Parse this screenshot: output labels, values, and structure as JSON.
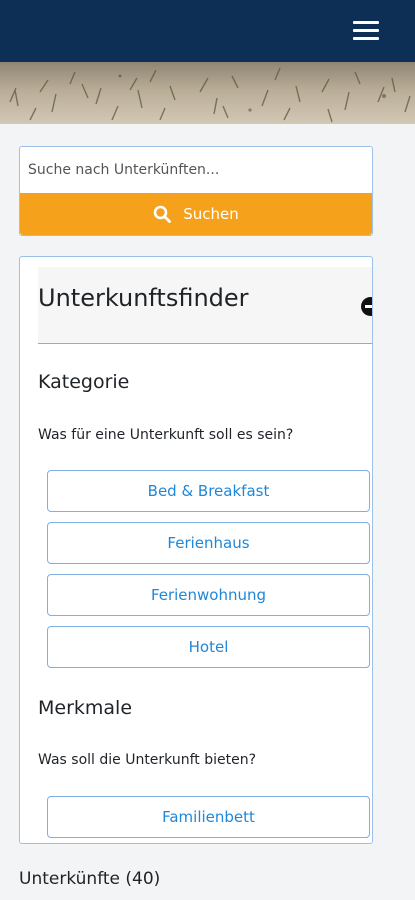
{
  "header": {
    "menu_icon": "hamburger-icon"
  },
  "search": {
    "placeholder": "Suche nach Unterkünften...",
    "button_label": "Suchen",
    "button_icon": "search-icon",
    "accent_color": "#f6a11c"
  },
  "finder": {
    "title": "Unterkunftsfinder",
    "collapse_icon": "minus-circle-icon",
    "category": {
      "heading": "Kategorie",
      "question": "Was für eine Unterkunft soll es sein?",
      "options": [
        "Bed & Breakfast",
        "Ferienhaus",
        "Ferienwohnung",
        "Hotel"
      ]
    },
    "features": {
      "heading": "Merkmale",
      "question": "Was soll die Unterkunft bieten?",
      "options": [
        "Familienbett"
      ]
    }
  },
  "results": {
    "label": "Unterkünfte (40)"
  },
  "colors": {
    "header_bg": "#0d2f55",
    "link_blue": "#1f87d8",
    "border_blue": "#9cc1e8"
  }
}
